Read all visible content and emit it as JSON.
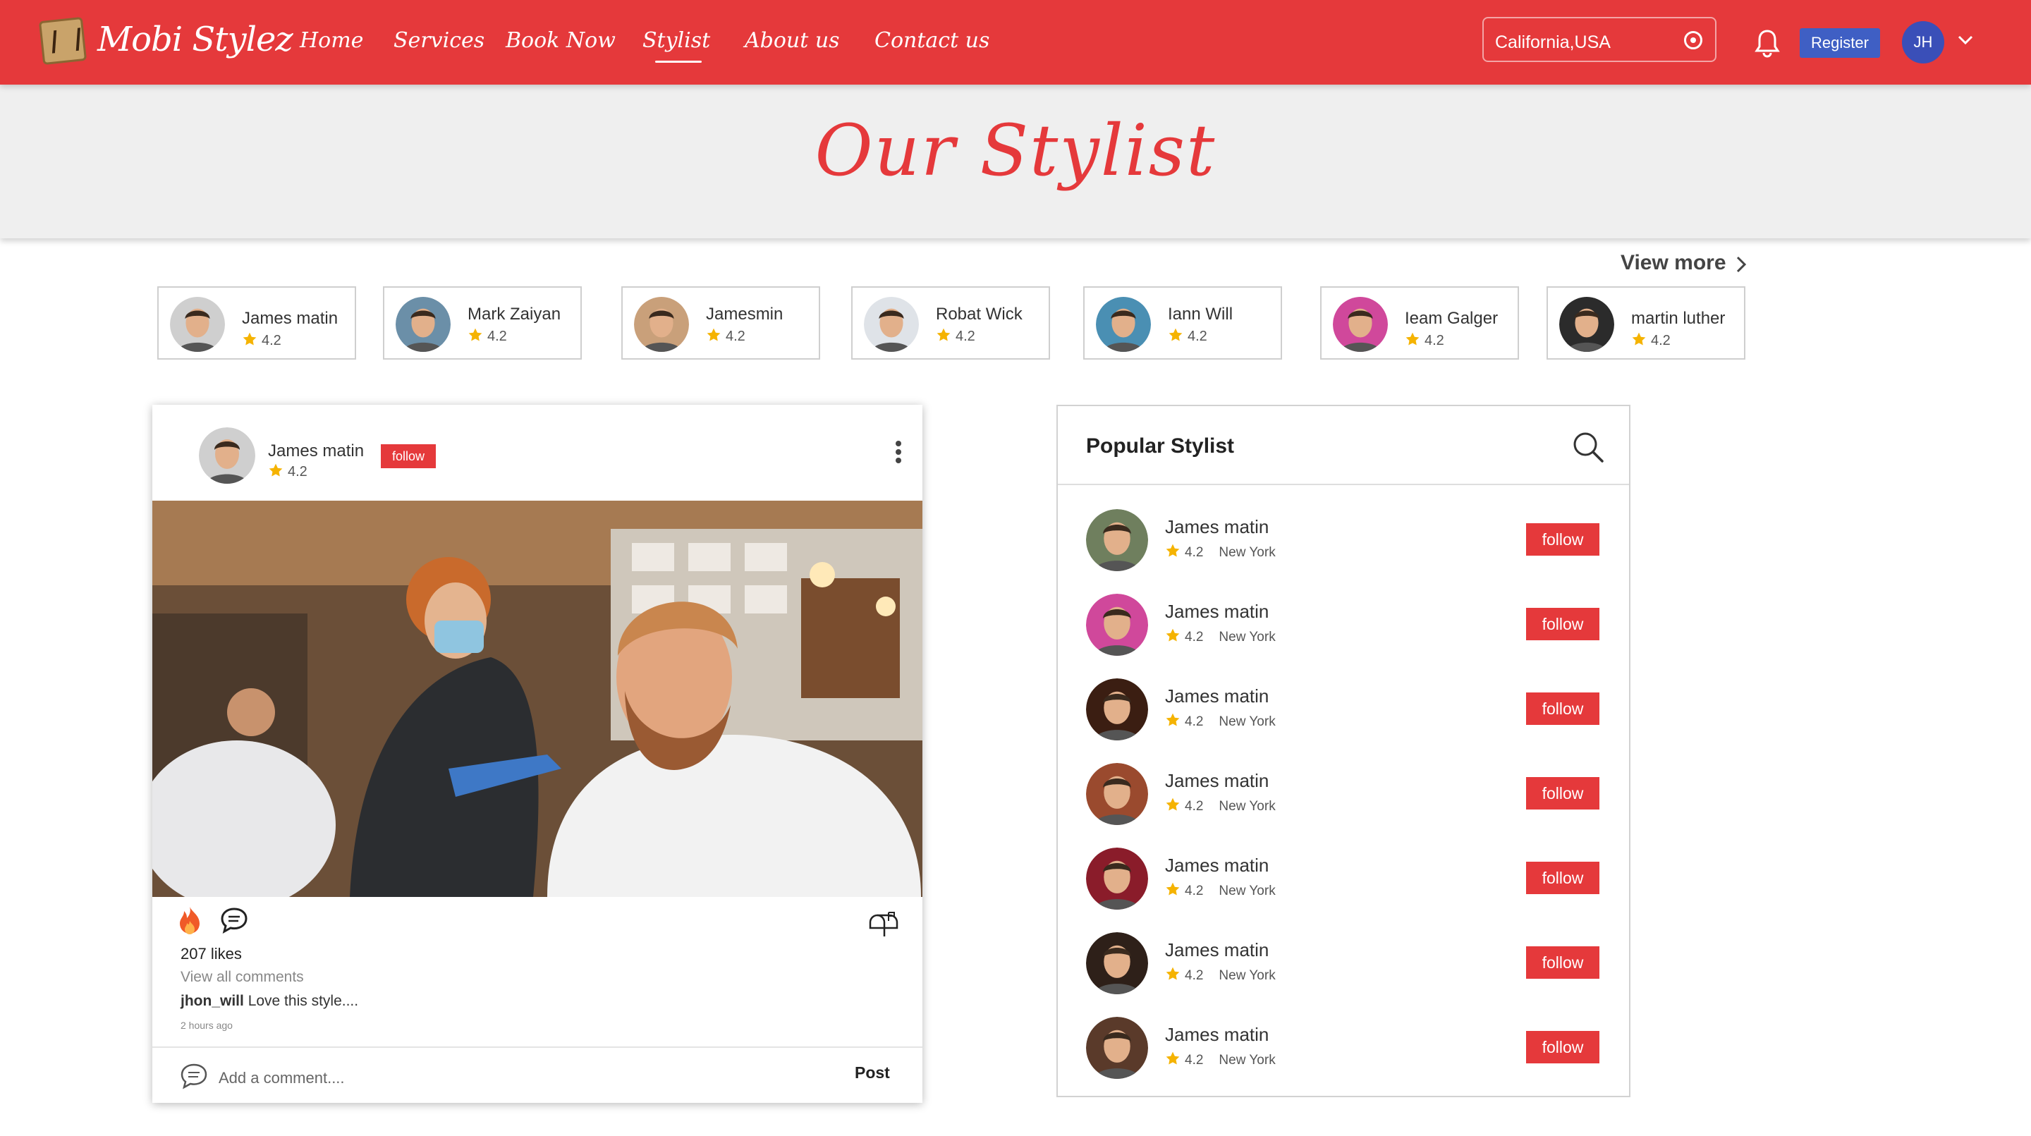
{
  "nav": {
    "brand": "Mobi Stylez",
    "links": [
      "Home",
      "Services",
      "Book Now",
      "Stylist",
      "About us",
      "Contact us"
    ],
    "active": "Stylist",
    "location": "California,USA",
    "register_label": "Register",
    "user_initials": "JH",
    "accent_color": "#e5393b",
    "icons": [
      "logo-icon",
      "location-target-icon",
      "bell-icon",
      "chevron-down-icon"
    ]
  },
  "hero": {
    "title": "Our Stylist"
  },
  "stylists": {
    "view_more": "View more",
    "cards": [
      {
        "name": "James matin",
        "rating": "4.2"
      },
      {
        "name": "Mark Zaiyan",
        "rating": "4.2"
      },
      {
        "name": "Jamesmin",
        "rating": "4.2"
      },
      {
        "name": "Robat Wick",
        "rating": "4.2"
      },
      {
        "name": "Iann Will",
        "rating": "4.2"
      },
      {
        "name": "Ieam Galger",
        "rating": "4.2"
      },
      {
        "name": "martin luther",
        "rating": "4.2"
      }
    ]
  },
  "post": {
    "author": "James matin",
    "rating": "4.2",
    "follow_label": "follow",
    "likes": "207 likes",
    "view_all": "View all comments",
    "comment_user": "jhon_will",
    "comment_text": "Love this style....",
    "time_ago": "2 hours ago",
    "add_comment_placeholder": "Add a comment....",
    "post_label": "Post",
    "icons": [
      "fire-icon",
      "comment-icon",
      "mailbox-icon",
      "more-vertical-icon"
    ]
  },
  "popular": {
    "title": "Popular Stylist",
    "items": [
      {
        "name": "James matin",
        "rating": "4.2",
        "city": "New York",
        "follow": "follow"
      },
      {
        "name": "James matin",
        "rating": "4.2",
        "city": "New York",
        "follow": "follow"
      },
      {
        "name": "James matin",
        "rating": "4.2",
        "city": "New York",
        "follow": "follow"
      },
      {
        "name": "James matin",
        "rating": "4.2",
        "city": "New York",
        "follow": "follow"
      },
      {
        "name": "James matin",
        "rating": "4.2",
        "city": "New York",
        "follow": "follow"
      },
      {
        "name": "James matin",
        "rating": "4.2",
        "city": "New York",
        "follow": "follow"
      },
      {
        "name": "James matin",
        "rating": "4.2",
        "city": "New York",
        "follow": "follow"
      }
    ]
  }
}
